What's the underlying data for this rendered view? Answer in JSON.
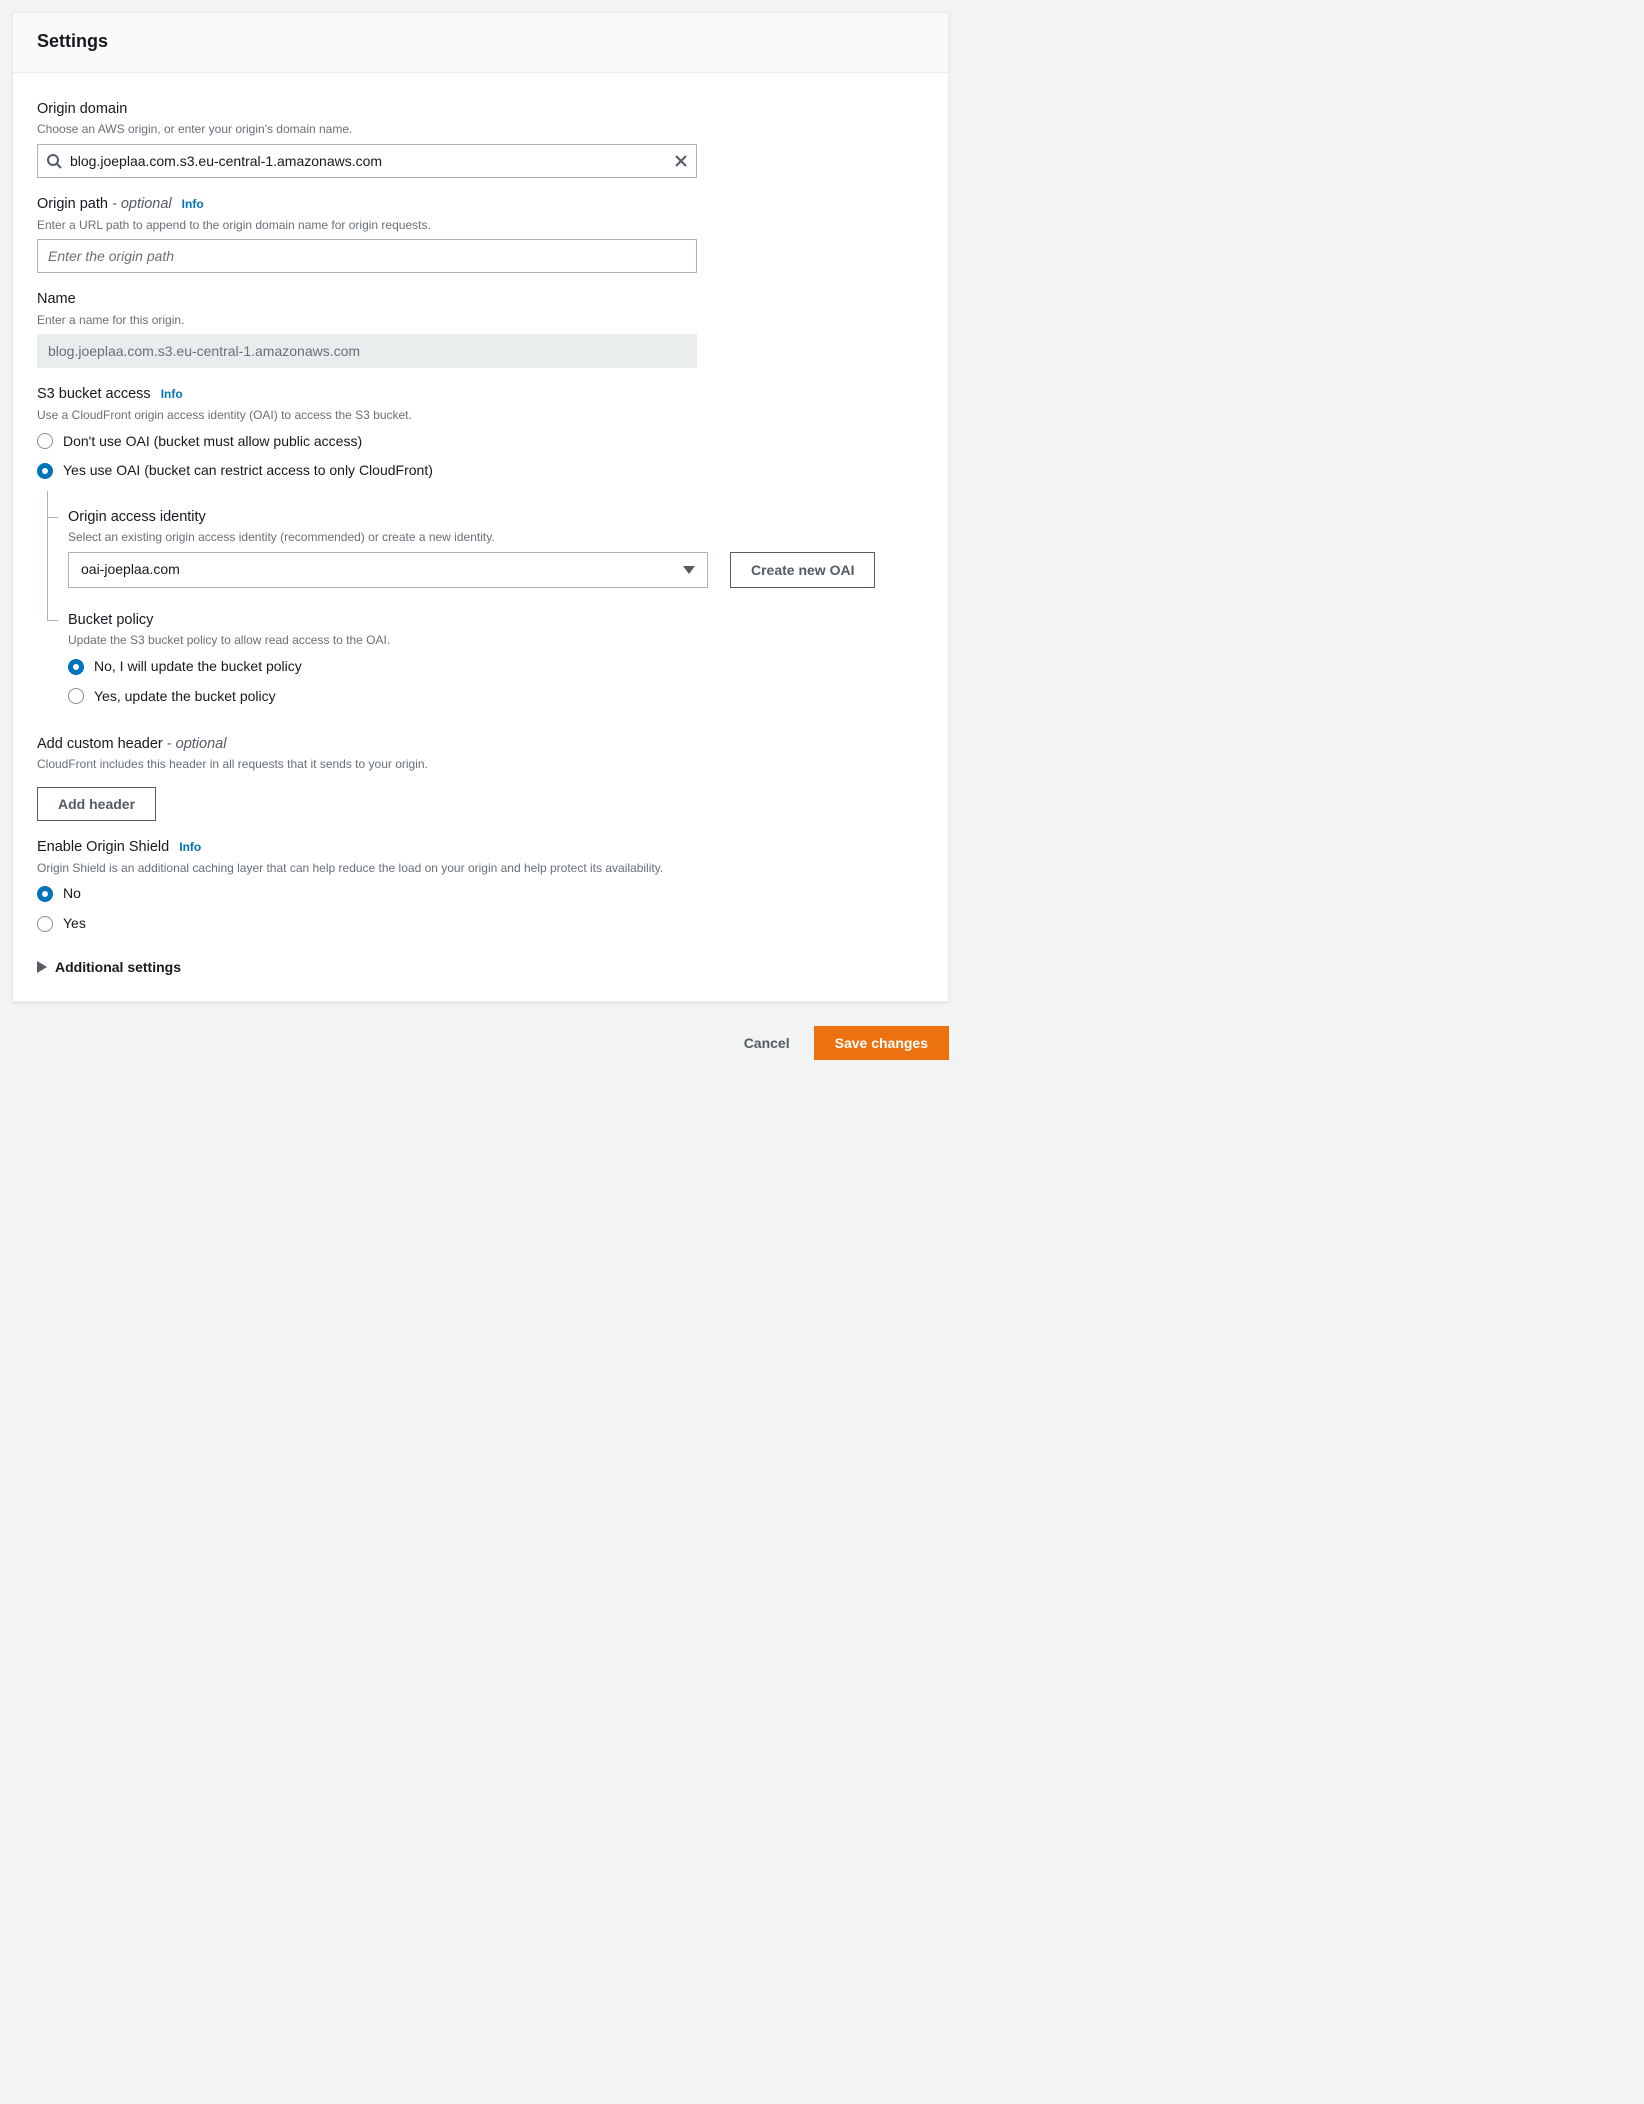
{
  "header": {
    "title": "Settings"
  },
  "origin_domain": {
    "label": "Origin domain",
    "help": "Choose an AWS origin, or enter your origin's domain name.",
    "value": "blog.joeplaa.com.s3.eu-central-1.amazonaws.com"
  },
  "origin_path": {
    "label": "Origin path",
    "optional_text": "- optional",
    "info": "Info",
    "help": "Enter a URL path to append to the origin domain name for origin requests.",
    "placeholder": "Enter the origin path",
    "value": ""
  },
  "name": {
    "label": "Name",
    "help": "Enter a name for this origin.",
    "value": "blog.joeplaa.com.s3.eu-central-1.amazonaws.com"
  },
  "s3_access": {
    "label": "S3 bucket access",
    "info": "Info",
    "help": "Use a CloudFront origin access identity (OAI) to access the S3 bucket.",
    "options": [
      "Don't use OAI (bucket must allow public access)",
      "Yes use OAI (bucket can restrict access to only CloudFront)"
    ],
    "selected": 1,
    "oai": {
      "label": "Origin access identity",
      "help": "Select an existing origin access identity (recommended) or create a new identity.",
      "value": "oai-joeplaa.com",
      "create_button": "Create new OAI"
    },
    "bucket_policy": {
      "label": "Bucket policy",
      "help": "Update the S3 bucket policy to allow read access to the OAI.",
      "options": [
        "No, I will update the bucket policy",
        "Yes, update the bucket policy"
      ],
      "selected": 0
    }
  },
  "custom_header": {
    "label": "Add custom header",
    "optional_text": "- optional",
    "help": "CloudFront includes this header in all requests that it sends to your origin.",
    "button": "Add header"
  },
  "origin_shield": {
    "label": "Enable Origin Shield",
    "info": "Info",
    "help": "Origin Shield is an additional caching layer that can help reduce the load on your origin and help protect its availability.",
    "options": [
      "No",
      "Yes"
    ],
    "selected": 0
  },
  "additional_settings": {
    "label": "Additional settings"
  },
  "footer": {
    "cancel": "Cancel",
    "save": "Save changes"
  }
}
